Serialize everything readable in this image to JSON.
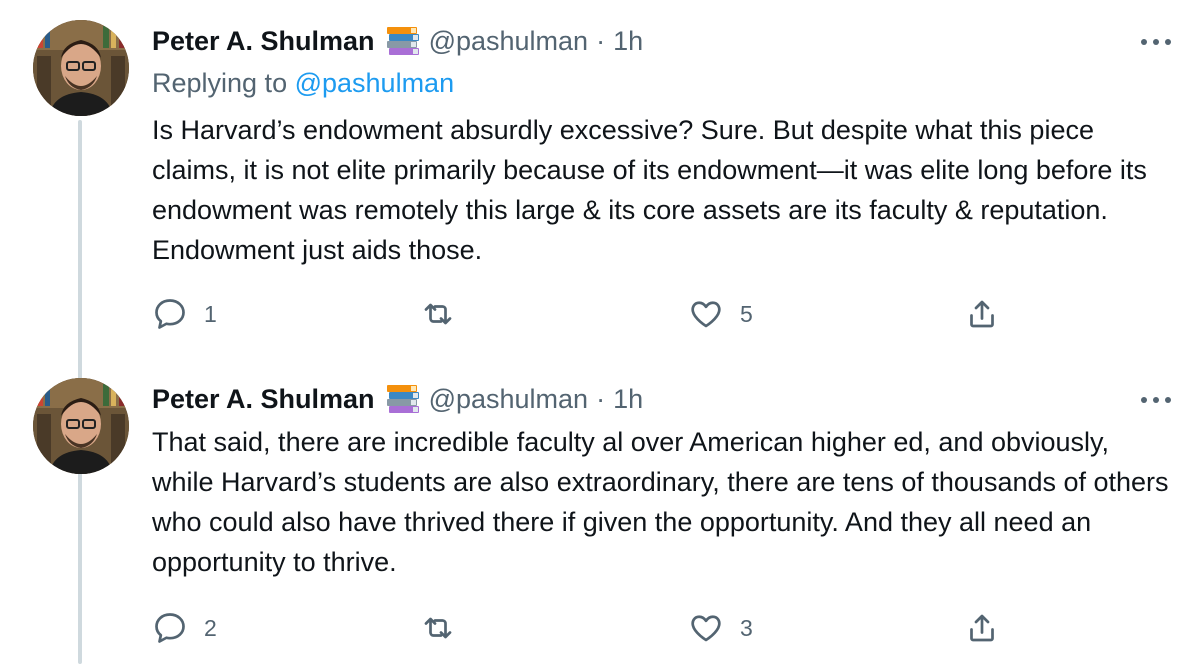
{
  "tweets": [
    {
      "author_name": "Peter A. Shulman",
      "handle": "@pashulman",
      "separator": "·",
      "time": "1h",
      "reply_prefix": "Replying to ",
      "reply_to": "@pashulman",
      "text": "Is Harvard’s endowment absurdly excessive? Sure. But despite what this piece claims, it is not elite primarily because of its endowment—it was elite long before its endowment was remotely this large & its core assets are its faculty & reputation. Endowment just aids those.",
      "reply_count": "1",
      "retweet_count": "",
      "like_count": "5"
    },
    {
      "author_name": "Peter A. Shulman",
      "handle": "@pashulman",
      "separator": "·",
      "time": "1h",
      "text": "That said, there are incredible faculty al over American higher ed, and obviously, while Harvard’s students are also extraordinary, there are tens of thousands of others who could also have thrived there if given the opportunity. And they all need an opportunity to thrive.",
      "reply_count": "2",
      "retweet_count": "",
      "like_count": "3"
    }
  ],
  "icons": {
    "badge": "books-emoji-icon",
    "more": "more-dots-icon",
    "reply": "reply-bubble-icon",
    "retweet": "retweet-icon",
    "like": "heart-icon",
    "share": "share-icon"
  },
  "colors": {
    "text": "#0f1419",
    "secondary": "#536471",
    "link": "#1d9bf0",
    "thread_line": "#cfd9de"
  }
}
